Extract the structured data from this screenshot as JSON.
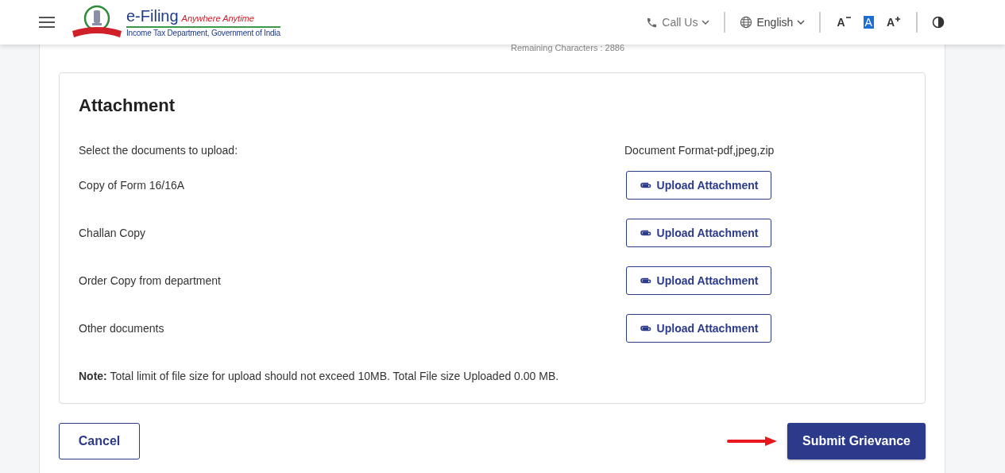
{
  "header": {
    "brand": "e-Filing",
    "tagline": "Anywhere Anytime",
    "department": "Income Tax Department, Government of India",
    "call_us": "Call Us",
    "language": "English",
    "font_controls": [
      {
        "kind": "decrease",
        "label": "A",
        "selected": false
      },
      {
        "kind": "normal",
        "label": "A",
        "selected": true
      },
      {
        "kind": "increase",
        "label": "A",
        "selected": false
      }
    ]
  },
  "remaining": "Remaining Characters : 2886",
  "attachment": {
    "title": "Attachment",
    "instruction": "Select the documents to upload:",
    "format": "Document Format-pdf,jpeg,zip",
    "documents": [
      {
        "label": "Copy of Form 16/16A",
        "button": "Upload Attachment"
      },
      {
        "label": "Challan Copy",
        "button": "Upload Attachment"
      },
      {
        "label": "Order Copy from department",
        "button": "Upload Attachment"
      },
      {
        "label": "Other documents",
        "button": "Upload Attachment"
      }
    ],
    "note": "**Note:** Total limit of file size for upload should not exceed 10MB. Total File size Uploaded 0.00 MB."
  },
  "actions": {
    "cancel": "Cancel",
    "submit": "Submit Grievance"
  }
}
